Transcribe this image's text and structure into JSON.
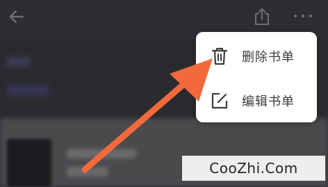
{
  "header": {
    "back_icon": "arrow-left-icon",
    "share_icon": "share-icon",
    "more_icon": "more-dots-icon"
  },
  "menu": {
    "items": [
      {
        "label": "删除书单",
        "icon": "trash-icon"
      },
      {
        "label": "编辑书单",
        "icon": "edit-icon"
      }
    ]
  },
  "annotation": {
    "arrow_color": "#f26a3c"
  },
  "watermark": {
    "text": "CooZhi.Com"
  }
}
